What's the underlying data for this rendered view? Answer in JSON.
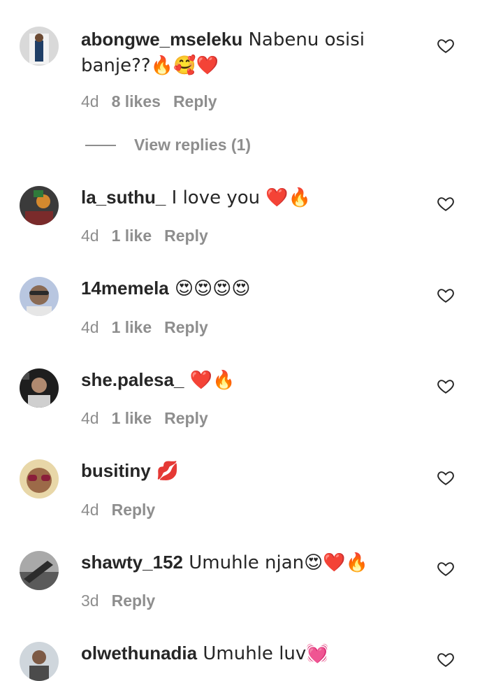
{
  "comments": [
    {
      "username": "abongwe_mseleku",
      "text": " Nabenu osisi banje??🔥🥰❤️",
      "age": "4d",
      "likes": "8 likes",
      "reply": "Reply"
    },
    {
      "username": "la_suthu_",
      "text": " I love you ❤️🔥",
      "age": "4d",
      "likes": "1 like",
      "reply": "Reply"
    },
    {
      "username": "14memela",
      "text": " 😍😍😍😍",
      "age": "4d",
      "likes": "1 like",
      "reply": "Reply"
    },
    {
      "username": "she.palesa_",
      "text": " ❤️🔥",
      "age": "4d",
      "likes": "1 like",
      "reply": "Reply"
    },
    {
      "username": "busitiny",
      "text": " 💋",
      "age": "4d",
      "likes": "",
      "reply": "Reply"
    },
    {
      "username": "shawty_152",
      "text": " Umuhle njan😍❤️🔥",
      "age": "3d",
      "likes": "",
      "reply": "Reply"
    },
    {
      "username": "olwethunadia",
      "text": " Umuhle luv💓",
      "age": "",
      "likes": "",
      "reply": ""
    }
  ],
  "view_replies": "View replies (1)",
  "icons": {
    "like": "heart-outline-icon",
    "avatar": "profile-avatar"
  }
}
